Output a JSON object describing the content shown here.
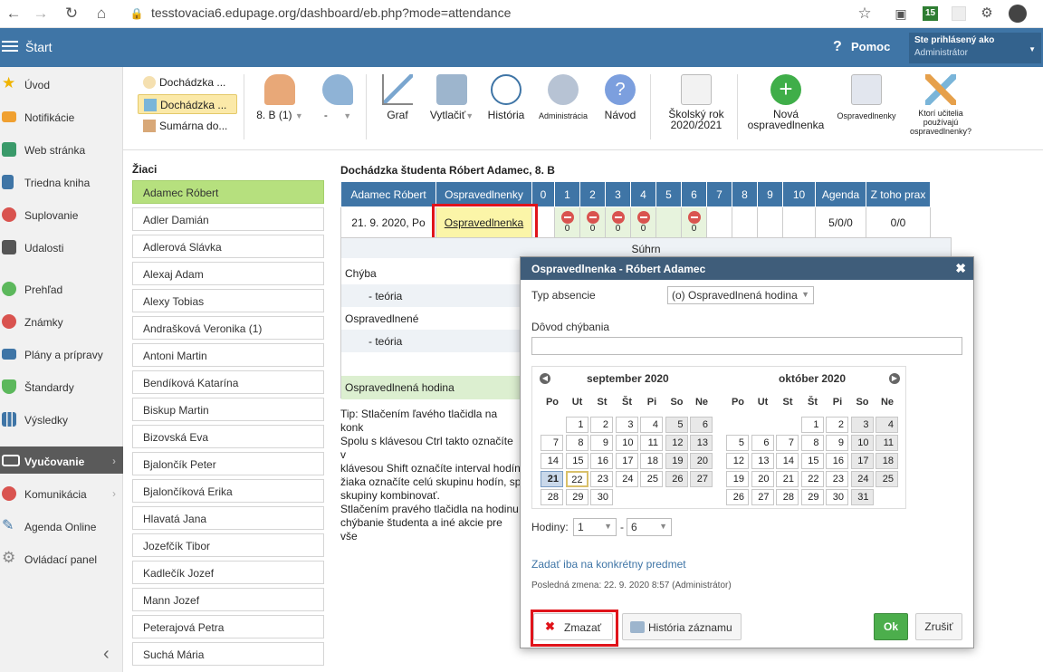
{
  "browser": {
    "url": "tesstovacia6.edupage.org/dashboard/eb.php?mode=attendance",
    "badge": "15"
  },
  "header": {
    "start": "Štart",
    "help": "Pomoc",
    "logged_label": "Ste prihlásený ako",
    "logged_user": "Administrátor"
  },
  "sidebar": {
    "items": [
      {
        "label": "Úvod",
        "icon": "star-icon",
        "color": "#f0b400"
      },
      {
        "label": "Notifikácie",
        "icon": "envelope-icon",
        "color": "#f0a030"
      },
      {
        "label": "Web stránka",
        "icon": "home-icon",
        "color": "#3a9a6a"
      },
      {
        "label": "Triedna kniha",
        "icon": "book-icon",
        "color": "#3f75a6"
      },
      {
        "label": "Suplovanie",
        "icon": "person-icon",
        "color": "#d9534f"
      },
      {
        "label": "Udalosti",
        "icon": "calendar-icon",
        "color": "#555555"
      },
      {
        "label": "Prehľad",
        "icon": "check-icon",
        "color": "#5cb85c"
      },
      {
        "label": "Známky",
        "icon": "grades-icon",
        "color": "#d9534f"
      },
      {
        "label": "Plány a prípravy",
        "icon": "briefcase-icon",
        "color": "#3f75a6"
      },
      {
        "label": "Štandardy",
        "icon": "shield-icon",
        "color": "#5cb85c"
      },
      {
        "label": "Výsledky",
        "icon": "barchart-icon",
        "color": "#3f75a6"
      },
      {
        "label": "Vyučovanie",
        "icon": "book-open-icon",
        "color": "#ffffff"
      },
      {
        "label": "Komunikácia",
        "icon": "chat-icon",
        "color": "#d9534f"
      },
      {
        "label": "Agenda Online",
        "icon": "pen-icon",
        "color": "#3f75a6"
      },
      {
        "label": "Ovládací panel",
        "icon": "gear-icon",
        "color": "#888888"
      }
    ]
  },
  "toolbar": {
    "submenu": [
      "Dochádzka ...",
      "Dochádzka ...",
      "Sumárna do..."
    ],
    "class_label": "8. B (1)",
    "dash": "-",
    "graf": "Graf",
    "print": "Vytlačiť",
    "history": "História",
    "admin": "Administrácia",
    "guide": "Návod",
    "year1": "Školský rok",
    "year2": "2020/2021",
    "new1": "Nová",
    "new2": "ospravedlnenka",
    "excuse": "Ospravedlnenky",
    "which1": "Ktorí učitelia",
    "which2": "používajú",
    "which3": "ospravedlnenky?"
  },
  "students": {
    "title": "Žiaci",
    "list": [
      "Adamec Róbert",
      "Adler Damián",
      "Adlerová Slávka",
      "Alexaj Adam",
      "Alexy Tobias",
      "Andrašková Veronika (1)",
      "Antoni Martin",
      "Bendíková Katarína",
      "Biskup Martin",
      "Bizovská Eva",
      "Bjalončík Peter",
      "Bjalončíková Erika",
      "Hlavatá Jana",
      "Jozefčík Tibor",
      "Kadlečík Jozef",
      "Mann Jozef",
      "Peterajová Petra",
      "Suchá Mária"
    ]
  },
  "attendance": {
    "title": "Dochádzka študenta Róbert Adamec, 8. B",
    "headers": [
      "Adamec Róbert",
      "Ospravedlnenky",
      "0",
      "1",
      "2",
      "3",
      "4",
      "5",
      "6",
      "7",
      "8",
      "9",
      "10",
      "Agenda",
      "Z toho prax"
    ],
    "row_date": "21. 9. 2020, Po",
    "row_link": "Ospravedlnenka",
    "zero": "0",
    "agenda": "5/0/0",
    "prax": "0/0",
    "summary": "Súhrn",
    "rows": [
      "Chýba",
      "- teória",
      "Ospravedlnené",
      "- teória",
      "Ospravedlnená hodina"
    ]
  },
  "tip": [
    "Tip: Stlačením ľavého tlačidla na konk",
    "Spolu s klávesou Ctrl takto označíte v",
    "klávesou Shift označíte interval hodín",
    "žiaka označíte celú skupinu hodín, sp",
    "skupiny kombinovať.",
    "Stlačením pravého tlačidla na hodinu",
    "chýbanie študenta a iné akcie pre vše"
  ],
  "dialog": {
    "title": "Ospravedlnenka - Róbert Adamec",
    "type_label": "Typ absencie",
    "type_value": "(o) Ospravedlnená hodina",
    "reason_label": "Dôvod chýbania",
    "reason_value": "",
    "cal": {
      "month1": "september 2020",
      "month2": "október 2020",
      "dows": [
        "Po",
        "Ut",
        "St",
        "Št",
        "Pi",
        "So",
        "Ne"
      ],
      "sep_days": [
        "1",
        "2",
        "3",
        "4",
        "5",
        "6",
        "7",
        "8",
        "9",
        "10",
        "11",
        "12",
        "13",
        "14",
        "15",
        "16",
        "17",
        "18",
        "19",
        "20",
        "21",
        "22",
        "23",
        "24",
        "25",
        "26",
        "27",
        "28",
        "29",
        "30"
      ],
      "oct_days": [
        "1",
        "2",
        "3",
        "4",
        "5",
        "6",
        "7",
        "8",
        "9",
        "10",
        "11",
        "12",
        "13",
        "14",
        "15",
        "16",
        "17",
        "18",
        "19",
        "20",
        "21",
        "22",
        "23",
        "24",
        "25",
        "26",
        "27",
        "28",
        "29",
        "30",
        "31"
      ]
    },
    "hours_label": "Hodiny:",
    "hour_from": "1",
    "hour_dash": "-",
    "hour_to": "6",
    "subject_link": "Zadať iba na konkrétny predmet",
    "last_change": "Posledná zmena: 22. 9. 2020 8:57 (Administrátor)",
    "delete": "Zmazať",
    "history": "História záznamu",
    "ok": "Ok",
    "cancel": "Zrušiť"
  }
}
